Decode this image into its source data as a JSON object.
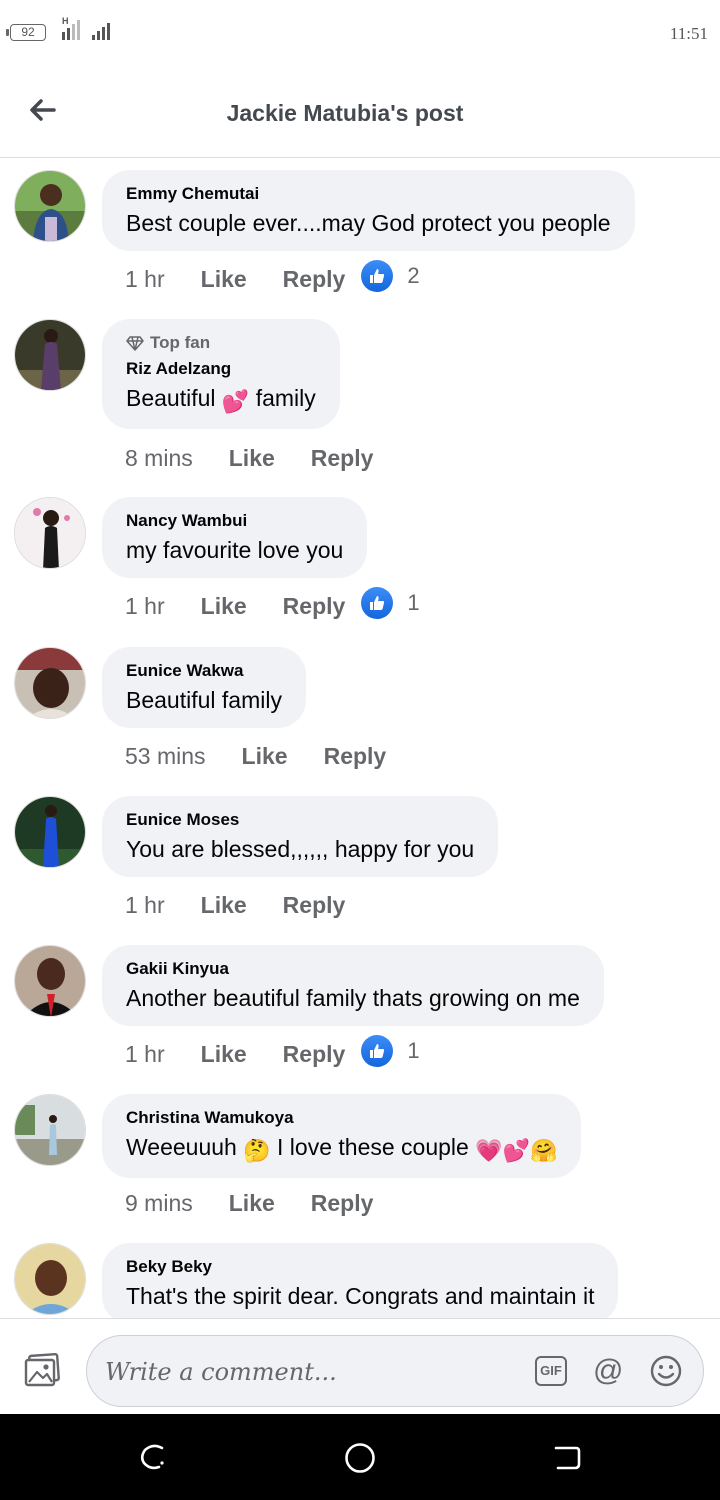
{
  "status_bar": {
    "battery": "92",
    "network": "H",
    "time": "11:51"
  },
  "header": {
    "title": "Jackie Matubia's post",
    "back_icon": "arrow-left-icon"
  },
  "colors": {
    "like_blue": "#1877f2",
    "bubble_bg": "#f0f2f5",
    "secondary_text": "#65676b"
  },
  "comments": [
    {
      "author": "Emmy Chemutai",
      "text": "Best couple ever....may God protect you people",
      "time": "1 hr",
      "like": "Like",
      "reply": "Reply",
      "reactions": "2"
    },
    {
      "badge": "Top fan",
      "author": "Riz Adelzang",
      "text_before": "Beautiful",
      "emoji": "💕",
      "text_after": "family",
      "time": "8 mins",
      "like": "Like",
      "reply": "Reply"
    },
    {
      "author": "Nancy Wambui",
      "text": "my favourite love you",
      "time": "1 hr",
      "like": "Like",
      "reply": "Reply",
      "reactions": "1"
    },
    {
      "author": "Eunice Wakwa",
      "text": "Beautiful family",
      "time": "53 mins",
      "like": "Like",
      "reply": "Reply"
    },
    {
      "author": "Eunice Moses",
      "text": "You are blessed,,,,,, happy for you",
      "time": "1 hr",
      "like": "Like",
      "reply": "Reply"
    },
    {
      "author": "Gakii Kinyua",
      "text": "Another beautiful family thats growing on me",
      "time": "1 hr",
      "like": "Like",
      "reply": "Reply",
      "reactions": "1"
    },
    {
      "author": "Christina Wamukoya",
      "text_before": "Weeeuuuh",
      "emoji1": "🤔",
      "text_after": "I love these couple",
      "emoji2": "💗",
      "emoji3": "💕",
      "emoji4": "🤗",
      "time": "9 mins",
      "like": "Like",
      "reply": "Reply"
    },
    {
      "author": "Beky Beky",
      "text": "That's the spirit dear. Congrats and maintain it"
    }
  ],
  "composer": {
    "placeholder": "Write a comment...",
    "gif_label": "GIF",
    "at_symbol": "@"
  }
}
